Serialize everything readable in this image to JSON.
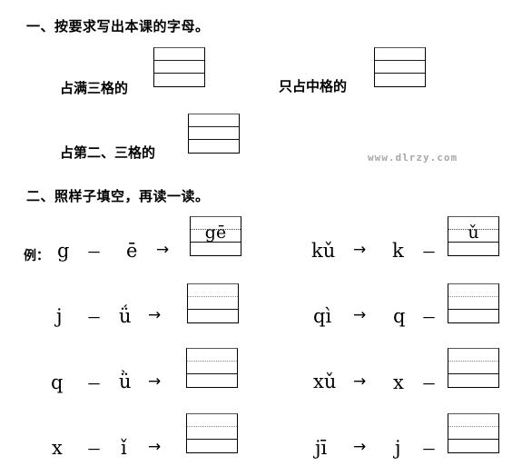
{
  "section1": {
    "title": "一、按要求写出本课的字母。",
    "items": [
      {
        "label": "占满三格的"
      },
      {
        "label": "只占中格的"
      },
      {
        "label": "占第二、三格的"
      }
    ]
  },
  "watermark": "www.dlrzy.com",
  "section2": {
    "title": "二、照样子填空，再读一读。",
    "example_prefix": "例：",
    "dash": "－",
    "arrow": "→",
    "left_rows": [
      {
        "initial": "g",
        "final": "ē",
        "answer": "gē"
      },
      {
        "initial": "j",
        "final": "ǘ",
        "answer": ""
      },
      {
        "initial": "q",
        "final": "ǜ",
        "answer": ""
      },
      {
        "initial": "x",
        "final": "ǐ",
        "answer": ""
      }
    ],
    "right_rows": [
      {
        "syllable": "kǔ",
        "initial": "k",
        "answer": "ǔ"
      },
      {
        "syllable": "qì",
        "initial": "q",
        "answer": ""
      },
      {
        "syllable": "xǔ",
        "initial": "x",
        "answer": ""
      },
      {
        "syllable": "jī",
        "initial": "j",
        "answer": ""
      }
    ]
  }
}
